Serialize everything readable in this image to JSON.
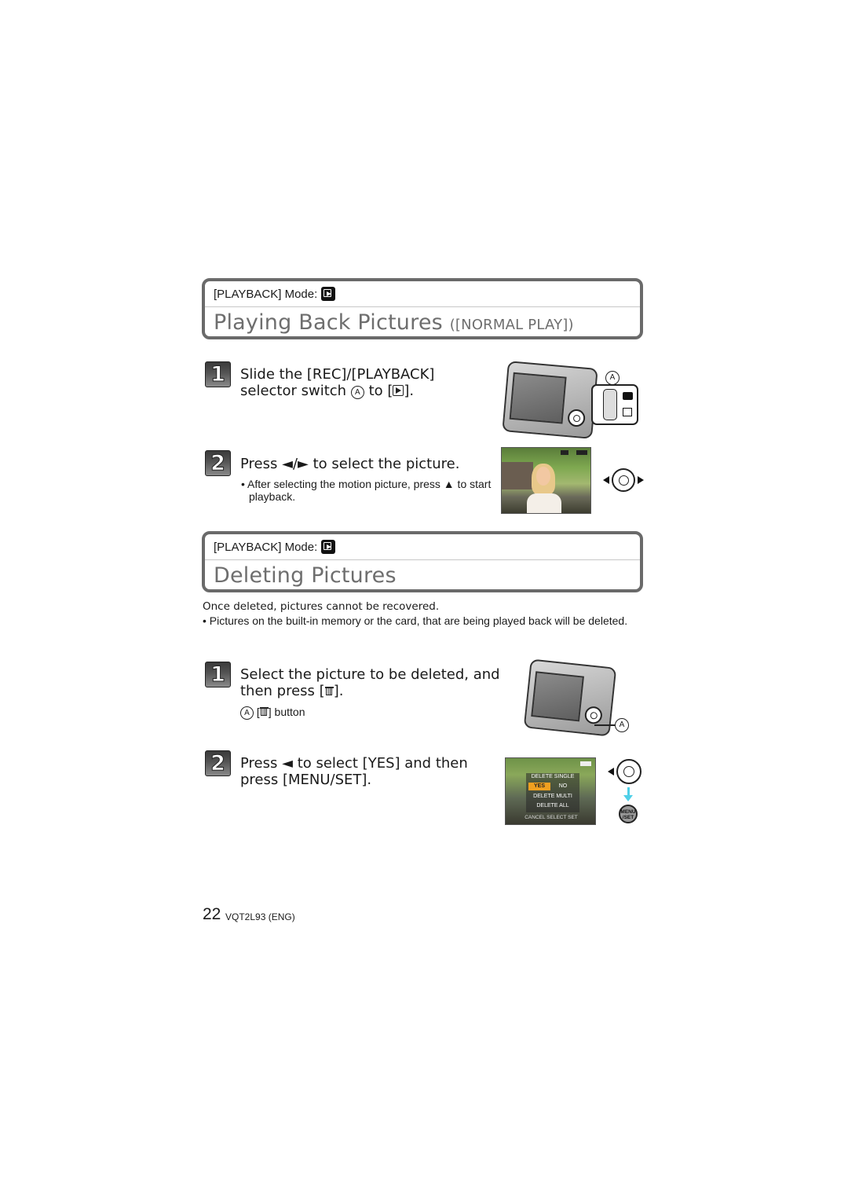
{
  "section1": {
    "mode_label": "[PLAYBACK] Mode:",
    "mode_icon": "playback-mode-icon",
    "title": "Playing Back Pictures",
    "title_sub": "([NORMAL PLAY])",
    "steps": [
      {
        "number": "1",
        "line1": "Slide the [REC]/[PLAYBACK]",
        "line2_pre": "selector switch",
        "line2_callout": "A",
        "line2_mid": "to [",
        "line2_post": "].",
        "illustration_callout": "A"
      },
      {
        "number": "2",
        "line1_pre": "Press",
        "line1_arrows": "◄/►",
        "line1_post": "to select the picture.",
        "note": "• After selecting the motion picture, press ▲ to start playback."
      }
    ]
  },
  "section2": {
    "mode_label": "[PLAYBACK] Mode:",
    "mode_icon": "playback-mode-icon",
    "title": "Deleting Pictures",
    "warning": "Once deleted, pictures cannot be recovered.",
    "bullet": "• Pictures on the built-in memory or the card, that are being played back will be deleted.",
    "steps": [
      {
        "number": "1",
        "line1": "Select the picture to be deleted, and",
        "line2_pre": "then press [",
        "line2_post": "].",
        "caption_callout": "A",
        "caption_pre": "[",
        "caption_post": "] button",
        "illustration_callout": "A"
      },
      {
        "number": "2",
        "line1_pre": "Press",
        "line1_arrow": "◄",
        "line1_post": "to select [YES] and then",
        "line2": "press [MENU/SET].",
        "screen_menu": {
          "title": "DELETE SINGLE",
          "options": [
            "YES",
            "NO"
          ],
          "selected": "YES",
          "items": [
            "DELETE MULTI",
            "DELETE ALL"
          ],
          "footer": "CANCEL SELECT SET"
        },
        "menu_button_label": "MENU /SET"
      }
    ]
  },
  "footer": {
    "page_number": "22",
    "doc_code": "VQT2L93 (ENG)"
  },
  "colors": {
    "box_border": "#6a6a6a",
    "title_gray": "#6e6e6e",
    "highlight_orange": "#f0a020",
    "arrow_cyan": "#4fd0e8"
  }
}
